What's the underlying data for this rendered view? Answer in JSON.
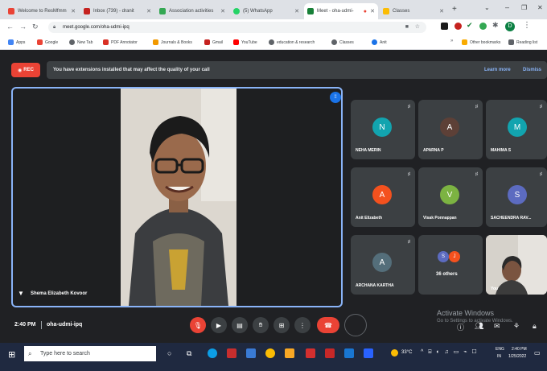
{
  "browser": {
    "tabs": [
      {
        "title": "Welcome to ResMfmm",
        "color": "#ea4335"
      },
      {
        "title": "Inbox (739) - dranit",
        "color": "#c5221f"
      },
      {
        "title": "Association activities",
        "color": "#34a853"
      },
      {
        "title": "(5) WhatsApp",
        "color": "#25d366"
      },
      {
        "title": "Meet - oha-udmi-",
        "color": "#188038"
      },
      {
        "title": "Classes",
        "color": "#fbbc04"
      }
    ],
    "url": "meet.google.com/oha-udmi-ipq",
    "bookmarks": [
      "Apps",
      "Google",
      "New Tab",
      "PDF Annotator",
      "Journals & Books",
      "Gmail",
      "YouTube",
      "education & research",
      "Classes",
      "Anit"
    ],
    "other_bookmarks": "Other bookmarks",
    "reading_list": "Reading list"
  },
  "meet": {
    "rec_label": "REC",
    "banner_text": "You have extensions installed that may affect the quality of your call",
    "learn_more": "Learn more",
    "dismiss": "Dismiss",
    "presenter_name": "Shema Elizabeth Kovoor",
    "participants": [
      {
        "initial": "N",
        "name": "NEHA MERIN",
        "color": "#12a4af"
      },
      {
        "initial": "A",
        "name": "APARNA P",
        "color": "#5d4037"
      },
      {
        "initial": "M",
        "name": "MAHIMA S",
        "color": "#12a4af"
      },
      {
        "initial": "A",
        "name": "Anit Elizabeth",
        "color": "#f4511e"
      },
      {
        "initial": "V",
        "name": "Visak Ponnappan",
        "color": "#7cb342"
      },
      {
        "initial": "S",
        "name": "SACHEENDRA RAV...",
        "color": "#5c6bc0"
      },
      {
        "initial": "A",
        "name": "ARCHANA KARTHA",
        "color": "#546e7a"
      }
    ],
    "others_label": "36 others",
    "others_initials": [
      "S",
      "J"
    ],
    "self_label": "You",
    "time": "2:40 PM",
    "meeting_code": "oha-udmi-ipq",
    "activate_title": "Activate Windows",
    "activate_sub": "Go to Settings to activate Windows."
  },
  "taskbar": {
    "search_placeholder": "Type here to search",
    "weather": "33°C",
    "lang": "ENG",
    "lang2": "IN",
    "clock_time": "2:40 PM",
    "clock_date": "1/25/2022"
  }
}
